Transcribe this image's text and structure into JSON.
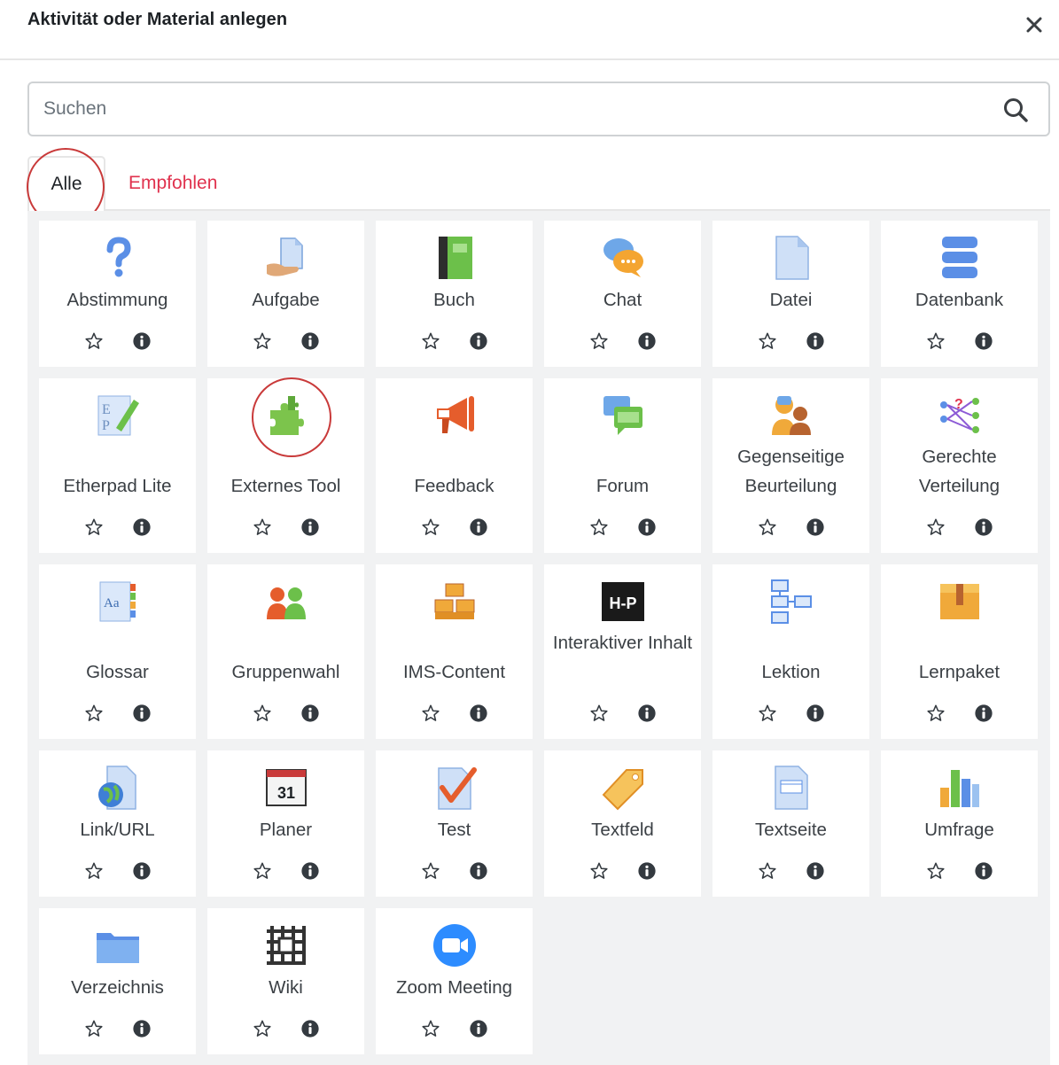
{
  "modal": {
    "title": "Aktivität oder Material anlegen",
    "close_label": "×"
  },
  "search": {
    "placeholder": "Suchen",
    "value": ""
  },
  "tabs": [
    {
      "label": "Alle",
      "active": true
    },
    {
      "label": "Empfohlen",
      "active": false
    }
  ],
  "colors": {
    "accent_link": "#e0324e",
    "highlight_circle": "#c93a3a",
    "panel_bg": "#f1f2f3"
  },
  "modules": [
    {
      "name": "Abstimmung",
      "icon": "question-mark-icon",
      "lines": 1
    },
    {
      "name": "Aufgabe",
      "icon": "assignment-hand-icon",
      "lines": 1
    },
    {
      "name": "Buch",
      "icon": "book-icon",
      "lines": 1
    },
    {
      "name": "Chat",
      "icon": "chat-bubble-icon",
      "lines": 1
    },
    {
      "name": "Datei",
      "icon": "file-icon",
      "lines": 1
    },
    {
      "name": "Datenbank",
      "icon": "database-icon",
      "lines": 1
    },
    {
      "name": "Etherpad Lite",
      "icon": "etherpad-icon",
      "lines": 1
    },
    {
      "name": "Externes Tool",
      "icon": "puzzle-icon",
      "lines": 1,
      "highlighted": true
    },
    {
      "name": "Feedback",
      "icon": "megaphone-icon",
      "lines": 1
    },
    {
      "name": "Forum",
      "icon": "forum-icon",
      "lines": 1
    },
    {
      "name": "Gegenseitige Beurteilung",
      "icon": "peer-review-icon",
      "lines": 2
    },
    {
      "name": "Gerechte Verteilung",
      "icon": "fair-allocation-icon",
      "lines": 2
    },
    {
      "name": "Glossar",
      "icon": "glossary-icon",
      "lines": 1
    },
    {
      "name": "Gruppenwahl",
      "icon": "group-choice-icon",
      "lines": 1
    },
    {
      "name": "IMS-Content",
      "icon": "ims-boxes-icon",
      "lines": 1
    },
    {
      "name": "Interaktiver Inhalt",
      "icon": "h5p-icon",
      "lines": 2,
      "icon_text": "H-P"
    },
    {
      "name": "Lektion",
      "icon": "lesson-flow-icon",
      "lines": 1
    },
    {
      "name": "Lernpaket",
      "icon": "package-icon",
      "lines": 1
    },
    {
      "name": "Link/URL",
      "icon": "globe-link-icon",
      "lines": 1
    },
    {
      "name": "Planer",
      "icon": "calendar-icon",
      "lines": 1,
      "icon_text": "31"
    },
    {
      "name": "Test",
      "icon": "quiz-check-icon",
      "lines": 1
    },
    {
      "name": "Textfeld",
      "icon": "label-tag-icon",
      "lines": 1
    },
    {
      "name": "Textseite",
      "icon": "page-icon",
      "lines": 1
    },
    {
      "name": "Umfrage",
      "icon": "bar-chart-icon",
      "lines": 1
    },
    {
      "name": "Verzeichnis",
      "icon": "folder-icon",
      "lines": 1
    },
    {
      "name": "Wiki",
      "icon": "wiki-icon",
      "lines": 1
    },
    {
      "name": "Zoom Meeting",
      "icon": "zoom-camera-icon",
      "lines": 1
    }
  ]
}
